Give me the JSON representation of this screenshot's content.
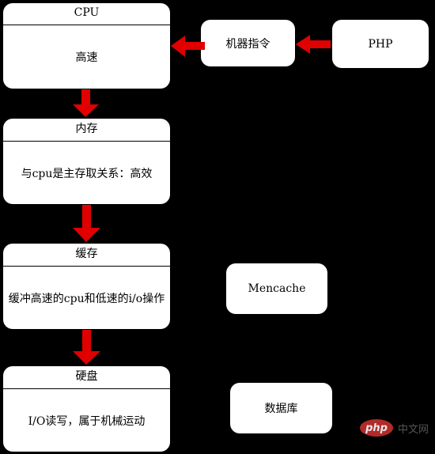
{
  "diagram": {
    "colors": {
      "background": "#000000",
      "box": "#ffffff",
      "arrow": "#e00000"
    },
    "stack": [
      {
        "title": "CPU",
        "description": "高速"
      },
      {
        "title": "内存",
        "description": "与cpu是主存取关系：高效"
      },
      {
        "title": "缓存",
        "description": "缓冲高速的cpu和低速的i/o操作"
      },
      {
        "title": "硬盘",
        "description": "I/O读写，属于机械运动"
      }
    ],
    "side_nodes": {
      "machine_instructions": "机器指令",
      "php": "PHP",
      "memcache": "Mencache",
      "database": "数据库"
    },
    "edges": [
      {
        "from": "PHP",
        "to": "机器指令"
      },
      {
        "from": "机器指令",
        "to": "CPU"
      },
      {
        "from": "CPU",
        "to": "内存"
      },
      {
        "from": "内存",
        "to": "缓存"
      },
      {
        "from": "缓存",
        "to": "硬盘"
      }
    ]
  },
  "watermark": {
    "logo": "php",
    "text": "中文网"
  }
}
